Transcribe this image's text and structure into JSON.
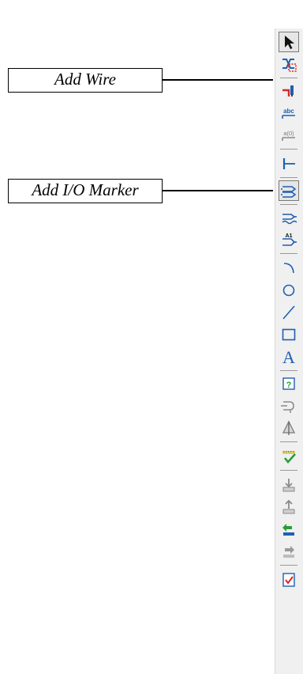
{
  "callouts": {
    "add_wire": "Add Wire",
    "add_io_marker": "Add I/O Marker"
  },
  "toolbar": {
    "tools": [
      {
        "name": "select-arrow-icon"
      },
      {
        "name": "add-net-icon"
      },
      {
        "name": "add-wire-icon"
      },
      {
        "name": "net-name-abc-icon",
        "text": "abc"
      },
      {
        "name": "bus-index-icon",
        "text": "a(0)"
      },
      {
        "name": "bus-tap-icon"
      },
      {
        "name": "add-io-marker-icon"
      },
      {
        "name": "add-branch-icon"
      },
      {
        "name": "attribute-a1-icon",
        "text": "A1"
      },
      {
        "name": "arc-icon"
      },
      {
        "name": "circle-icon"
      },
      {
        "name": "line-icon"
      },
      {
        "name": "rectangle-icon"
      },
      {
        "name": "text-icon",
        "text": "A"
      },
      {
        "name": "help-icon",
        "text": "?"
      },
      {
        "name": "connector-icon"
      },
      {
        "name": "symbol-icon"
      },
      {
        "name": "check-schematic-icon"
      },
      {
        "name": "push-down-icon"
      },
      {
        "name": "pop-up-icon"
      },
      {
        "name": "back-green-icon"
      },
      {
        "name": "forward-icon"
      },
      {
        "name": "checklist-icon"
      }
    ]
  },
  "colors": {
    "icon_blue": "#1f5fb0",
    "icon_red": "#d62828",
    "icon_green": "#2a9d3a",
    "icon_gray": "#8a8a8a",
    "icon_yellow": "#e8d44d"
  }
}
